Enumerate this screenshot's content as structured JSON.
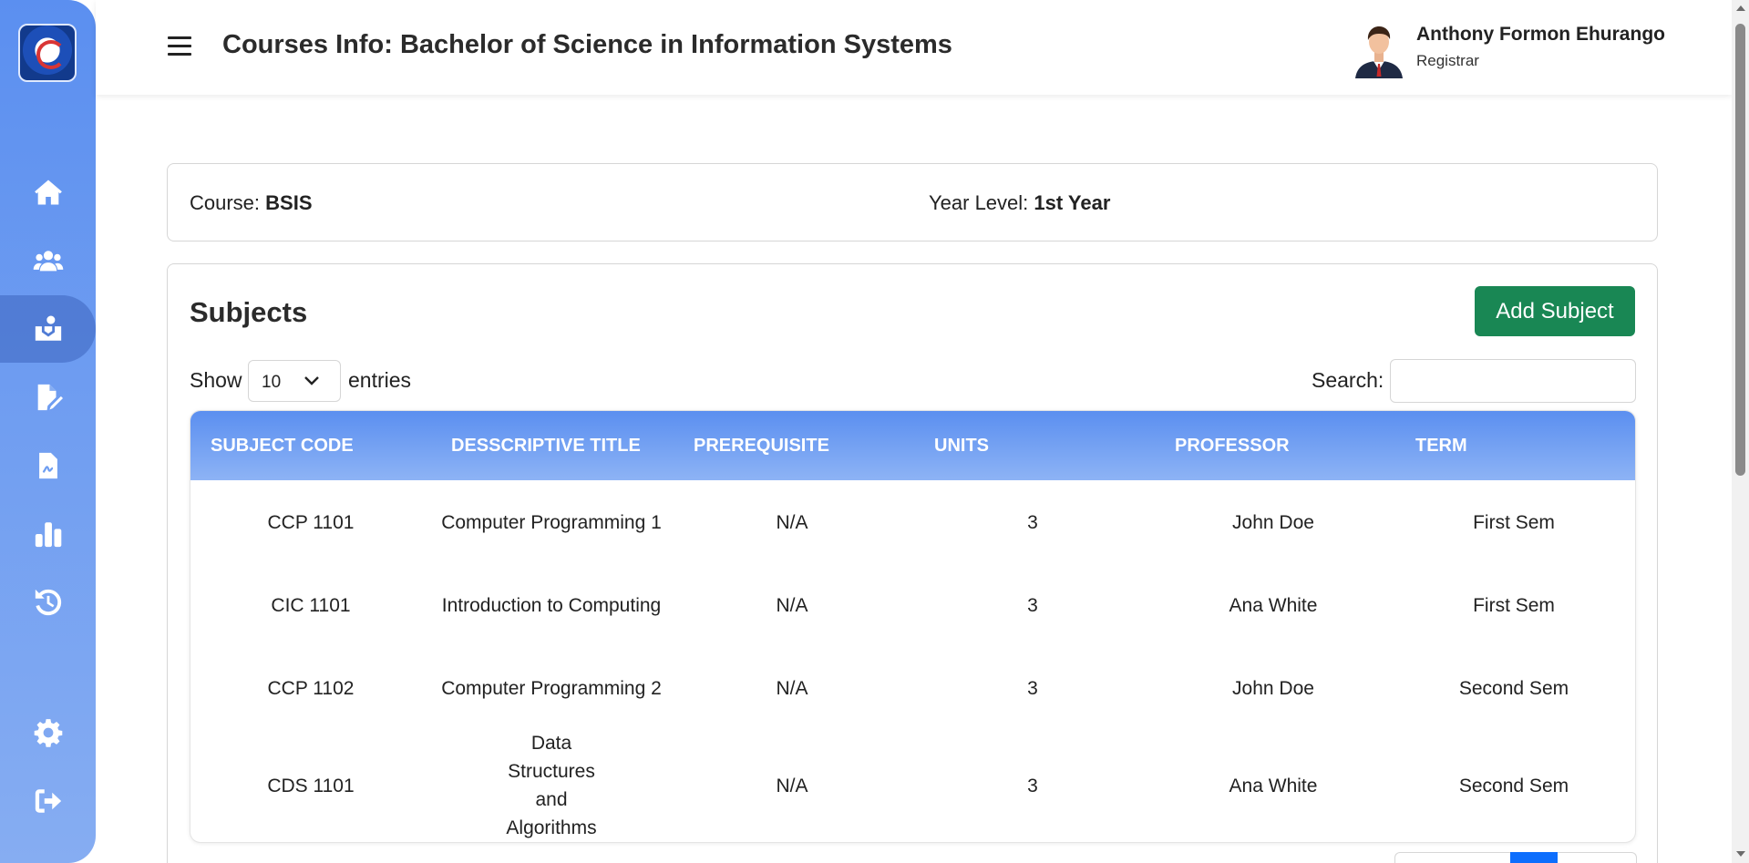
{
  "header": {
    "title": "Courses Info: Bachelor of Science in Information Systems",
    "user_name": "Anthony Formon Ehurango",
    "user_role": "Registrar"
  },
  "sidebar": {
    "items": [
      {
        "icon": "home-icon"
      },
      {
        "icon": "users-icon"
      },
      {
        "icon": "course-reader-icon",
        "active": true
      },
      {
        "icon": "edit-document-icon"
      },
      {
        "icon": "report-document-icon"
      },
      {
        "icon": "bar-chart-icon"
      },
      {
        "icon": "history-icon"
      },
      {
        "icon": "gear-icon"
      },
      {
        "icon": "logout-icon"
      }
    ]
  },
  "course_info": {
    "course_label": "Course:",
    "course_value": "BSIS",
    "year_label": "Year Level:",
    "year_value": "1st Year"
  },
  "subjects": {
    "title": "Subjects",
    "add_button": "Add Subject",
    "show_label": "Show",
    "entries_value": "10",
    "entries_label": "entries",
    "search_label": "Search:",
    "search_value": "",
    "columns": [
      "SUBJECT CODE",
      "DESSCRIPTIVE TITLE",
      "PREREQUISITE",
      "UNITS",
      "PROFESSOR",
      "TERM"
    ],
    "rows": [
      {
        "code": "CCP 1101",
        "title": "Computer Programming 1",
        "prereq": "N/A",
        "units": "3",
        "professor": "John Doe",
        "term": "First Sem"
      },
      {
        "code": "CIC 1101",
        "title": "Introduction to Computing",
        "prereq": "N/A",
        "units": "3",
        "professor": "Ana White",
        "term": "First Sem"
      },
      {
        "code": "CCP 1102",
        "title": "Computer Programming 2",
        "prereq": "N/A",
        "units": "3",
        "professor": "John Doe",
        "term": "Second Sem"
      },
      {
        "code": "CDS 1101",
        "title": "Data Structures and Algorithms",
        "prereq": "N/A",
        "units": "3",
        "professor": "Ana White",
        "term": "Second Sem"
      }
    ]
  },
  "colors": {
    "sidebar_top": "#5b8ff0",
    "sidebar_bottom": "#86adf2",
    "add_button": "#198754",
    "pager_active": "#0d6efd"
  }
}
